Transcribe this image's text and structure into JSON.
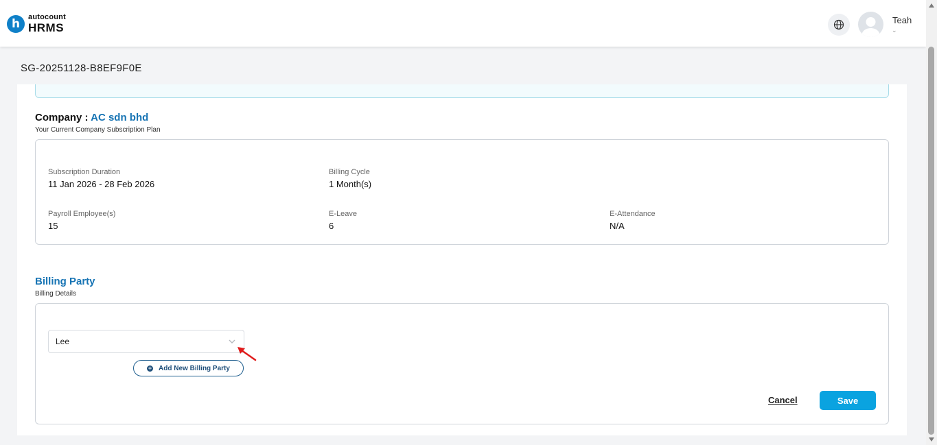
{
  "header": {
    "logo_small": "autocount",
    "logo_big": "HRMS",
    "logo_badge": "h",
    "user_name": "Teah",
    "user_chevron": "⌄"
  },
  "page": {
    "id": "SG-20251128-B8EF9F0E"
  },
  "company": {
    "label": "Company : ",
    "name": "AC sdn bhd",
    "subtitle": "Your Current Company Subscription Plan"
  },
  "plan": {
    "subscription_duration_label": "Subscription Duration",
    "subscription_duration_value": "11 Jan 2026 - 28 Feb 2026",
    "billing_cycle_label": "Billing Cycle",
    "billing_cycle_value": "1 Month(s)",
    "payroll_label": "Payroll Employee(s)",
    "payroll_value": "15",
    "eleave_label": "E-Leave",
    "eleave_value": "6",
    "eattendance_label": "E-Attendance",
    "eattendance_value": "N/A"
  },
  "billing": {
    "title": "Billing Party",
    "subtitle": "Billing Details",
    "selected_party": "Lee",
    "add_button": "Add New Billing Party",
    "cancel_label": "Cancel",
    "save_label": "Save"
  },
  "colors": {
    "primary": "#0aa3e0",
    "brand_blue": "#1774b4",
    "annotation_arrow": "#e01b1b"
  },
  "icons": {
    "globe": "globe-icon",
    "avatar": "avatar",
    "chevron": "chevron-down-icon",
    "plus": "plus-circle-icon",
    "annotation": "red-arrow-icon"
  }
}
